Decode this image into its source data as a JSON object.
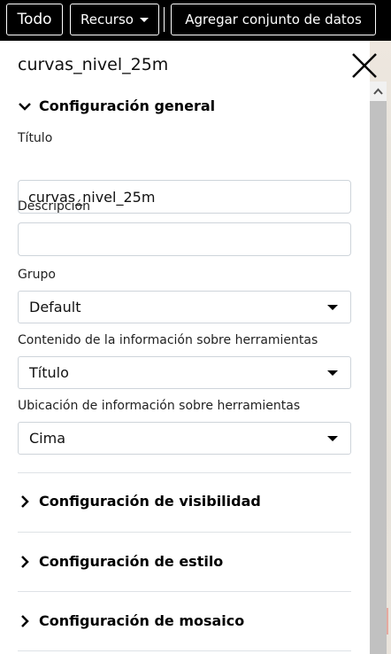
{
  "toolbar": {
    "todo_label": "Todo",
    "recurso_label": "Recurso",
    "agregar_label": "Agregar conjunto de datos"
  },
  "panel": {
    "title": "curvas_nivel_25m",
    "sections": {
      "general": "Configuración general",
      "visibility": "Configuración de visibilidad",
      "style": "Configuración de estilo",
      "mosaic": "Configuración de mosaico"
    },
    "fields": {
      "title_label": "Título",
      "title_value": "curvas_nivel_25m",
      "description_label": "Descripción",
      "description_value": "",
      "group_label": "Grupo",
      "group_value": "Default",
      "tooltip_content_label": "Contenido de la información sobre herramientas",
      "tooltip_content_value": "Título",
      "tooltip_location_label": "Ubicación de información sobre herramientas",
      "tooltip_location_value": "Cima"
    }
  },
  "icons": {
    "close": "close-icon",
    "expanded": "chevron-down-icon",
    "collapsed": "chevron-right-icon",
    "caret": "caret-down-icon"
  }
}
